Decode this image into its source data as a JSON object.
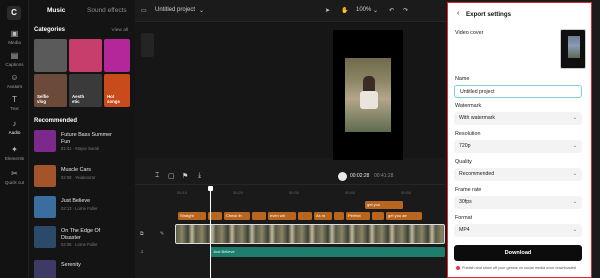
{
  "rail": {
    "items": [
      {
        "label": "Media",
        "icon": "media-icon"
      },
      {
        "label": "Captions",
        "icon": "captions-icon"
      },
      {
        "label": "Avatars",
        "icon": "avatar-icon"
      },
      {
        "label": "Text",
        "icon": "text-icon"
      },
      {
        "label": "Audio",
        "icon": "audio-icon"
      },
      {
        "label": "Elements",
        "icon": "elements-icon"
      },
      {
        "label": "Quick cut",
        "icon": "scissors-icon"
      }
    ]
  },
  "panel": {
    "tab_music": "Music",
    "tab_sound": "Sound effects",
    "categories_heading": "Categories",
    "view_all": "View all",
    "categories": [
      {
        "label": "",
        "color": "#5a5a5a"
      },
      {
        "label": "",
        "color": "#c73e6d"
      },
      {
        "label": "",
        "color": "#b3279a"
      },
      {
        "label": "Selfie\nvlog",
        "color": "#6b4a3a"
      },
      {
        "label": "Aesth\netic",
        "color": "#3a3a3a"
      },
      {
        "label": "Hot\nsongs",
        "color": "#c94a1a"
      }
    ],
    "recommended_heading": "Recommended",
    "tracks": [
      {
        "title": "Future Bass Summer Fun",
        "meta": "01:41 · Mayur Surati",
        "color": "#7b2a8c"
      },
      {
        "title": "Muscle Cars",
        "meta": "02:08 · Yeiaboorat",
        "color": "#a5532b"
      },
      {
        "title": "Just Believe",
        "meta": "02:13 · Lorne Fuller",
        "color": "#3b6ea0"
      },
      {
        "title": "On The Edge Of Disaster",
        "meta": "02:35 · Lorne Fuller",
        "color": "#2b4a6a"
      },
      {
        "title": "Serenity",
        "meta": "",
        "color": "#3e3a66"
      }
    ]
  },
  "topbar": {
    "project_title": "Untitled project",
    "zoom": "100%"
  },
  "player": {
    "current_time": "00:02:28",
    "total_time": "00:41:28"
  },
  "timeline": {
    "ruler": [
      "00:10",
      "00:20",
      "00:30",
      "00:40",
      "00:50"
    ],
    "chips_row1": [
      "Straight",
      "",
      "Check th",
      "",
      "even wit",
      "",
      "As m",
      "",
      "Perfect",
      "",
      "get you ae"
    ],
    "chip_single": "get you",
    "audio_label": "Just Believe"
  },
  "export": {
    "title": "Export settings",
    "video_cover_label": "Video cover",
    "name_label": "Name",
    "name_value": "Untitled project",
    "watermark_label": "Watermark",
    "watermark_value": "With watermark",
    "resolution_label": "Resolution",
    "resolution_value": "720p",
    "quality_label": "Quality",
    "quality_value": "Recommended",
    "framerate_label": "Frame rate",
    "framerate_value": "30fps",
    "format_label": "Format",
    "format_value": "MP4",
    "download_label": "Download",
    "footer_note": "Publish and show off your genius on social media once downloaded"
  }
}
